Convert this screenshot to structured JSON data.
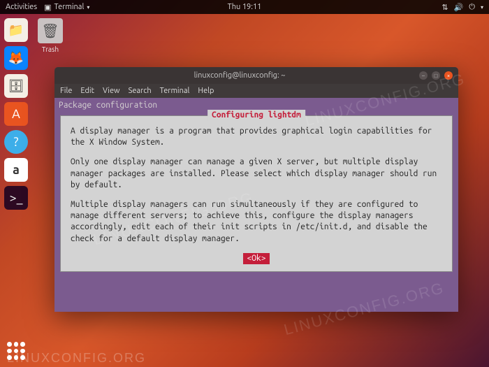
{
  "topbar": {
    "activities": "Activities",
    "app_name": "Terminal",
    "clock": "Thu 19:11"
  },
  "desktop": {
    "trash_label": "Trash"
  },
  "window": {
    "title": "linuxconfig@linuxconfig: ~",
    "menu": {
      "file": "File",
      "edit": "Edit",
      "view": "View",
      "search": "Search",
      "terminal": "Terminal",
      "help": "Help"
    }
  },
  "dialog": {
    "header": "Package configuration",
    "title": "Configuring lightdm",
    "p1": "A display manager is a program that provides graphical login capabilities for the X Window System.",
    "p2": "Only one display manager can manage a given X server, but multiple display manager packages are installed. Please select which display manager should run by default.",
    "p3": "Multiple display managers can run simultaneously if they are configured to manage different servers; to achieve this, configure the display managers accordingly, edit each of their init scripts in /etc/init.d, and disable the check for a default display manager.",
    "ok": "<Ok>"
  },
  "watermark": "LINUXCONFIG.ORG"
}
